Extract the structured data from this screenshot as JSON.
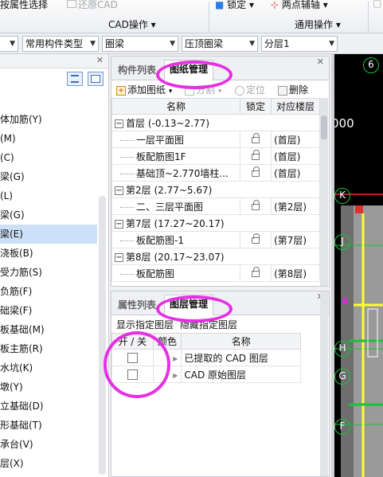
{
  "ribbon": {
    "top_left_label": "按属性选择",
    "restore_cad_label": "还原CAD",
    "cad_ops_group": "CAD操作",
    "lock_label": "锁定",
    "two_point_aux_label": "两点辅轴",
    "common_ops_group": "通用操作",
    "dropdown_arrow": "▾"
  },
  "filterbar": {
    "combos": [
      {
        "value": "常用构件类型"
      },
      {
        "value": "圈梁"
      },
      {
        "value": "压顶圈梁"
      },
      {
        "value": "分层1"
      }
    ]
  },
  "left_panel": {
    "items": [
      "体加筋(Y)",
      "(M)",
      "(C)",
      "梁(G)",
      "(L)",
      "梁(G)",
      "梁(E)",
      "浇板(B)",
      "受力筋(S)",
      "负筋(F)",
      "础梁(F)",
      "板基础(M)",
      "板主筋(R)",
      "水坑(K)",
      "墩(Y)",
      "立基础(D)",
      "形基础(T)",
      "承台(V)",
      "层(X)"
    ],
    "selected_index": 6
  },
  "drawing_panel": {
    "tab_component_list": "构件列表",
    "tab_drawing_manage": "图纸管理",
    "toolbar": {
      "add_drawing": "添加图纸",
      "split": "分割",
      "locate": "定位",
      "delete": "删除"
    },
    "columns": [
      "名称",
      "锁定",
      "对应楼层"
    ],
    "rows": [
      {
        "kind": "group",
        "name": "首层 (-0.13~2.77)",
        "floor": ""
      },
      {
        "kind": "child",
        "name": "一层平面图",
        "floor": "(首层)"
      },
      {
        "kind": "child",
        "name": "板配筋图1F",
        "floor": "(首层)"
      },
      {
        "kind": "child",
        "name": "基础顶~2.770墙柱...",
        "floor": "(首层)"
      },
      {
        "kind": "group",
        "name": "第2层 (2.77~5.67)",
        "floor": ""
      },
      {
        "kind": "child",
        "name": "二、三层平面图",
        "floor": "(第2层)"
      },
      {
        "kind": "group",
        "name": "第7层 (17.27~20.17)",
        "floor": ""
      },
      {
        "kind": "child",
        "name": "板配筋图-1",
        "floor": "(第7层)"
      },
      {
        "kind": "group",
        "name": "第8层 (20.17~23.07)",
        "floor": ""
      },
      {
        "kind": "child",
        "name": "板配筋图",
        "floor": "(第8层)"
      }
    ],
    "expand_symbol": "−"
  },
  "layer_panel": {
    "tab_property_list": "属性列表",
    "tab_layer_manage": "图层管理",
    "show_specified": "显示指定图层",
    "hide_specified": "隐藏指定图层",
    "columns": [
      "开 / 关",
      "颜色",
      "名称"
    ],
    "rows": [
      {
        "name": "已提取的 CAD 图层"
      },
      {
        "name": "CAD 原始图层"
      }
    ]
  },
  "cad_view": {
    "partial_number": "000",
    "axis_top": "6",
    "axis_labels": [
      "K",
      "J",
      "H",
      "G",
      "F"
    ],
    "colors": {
      "bg": "#000000",
      "axis": "#19c23a",
      "accent_red": "#e03030",
      "wall_gray": "#9a9a9a"
    }
  },
  "colors": {
    "highlight": "#e62ee3",
    "selection": "#cce0f7"
  }
}
